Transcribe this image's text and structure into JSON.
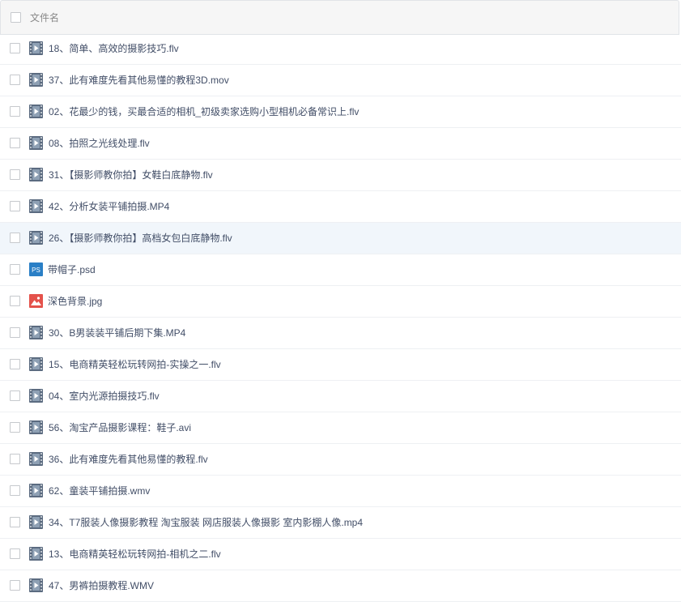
{
  "header": {
    "column_label": "文件名"
  },
  "files": [
    {
      "name": "18、简单、高效的摄影技巧.flv",
      "icon": "video-icon"
    },
    {
      "name": "37、此有难度先看其他易懂的教程3D.mov",
      "icon": "video-icon"
    },
    {
      "name": "02、花最少的钱，买最合适的相机_初级卖家选购小型相机必备常识上.flv",
      "icon": "video-icon"
    },
    {
      "name": "08、拍照之光线处理.flv",
      "icon": "video-icon"
    },
    {
      "name": "31、【摄影师教你拍】女鞋白底静物.flv",
      "icon": "video-icon"
    },
    {
      "name": "42、分析女装平铺拍摄.MP4",
      "icon": "video-icon"
    },
    {
      "name": "26、【摄影师教你拍】高档女包白底静物.flv",
      "icon": "video-icon",
      "hover": true
    },
    {
      "name": "带帽子.psd",
      "icon": "psd-icon"
    },
    {
      "name": "深色背景.jpg",
      "icon": "image-icon"
    },
    {
      "name": "30、B男装装平铺后期下集.MP4",
      "icon": "video-icon"
    },
    {
      "name": "15、电商精英轻松玩转网拍-实操之一.flv",
      "icon": "video-icon"
    },
    {
      "name": "04、室内光源拍摄技巧.flv",
      "icon": "video-icon"
    },
    {
      "name": "56、淘宝产品摄影课程：鞋子.avi",
      "icon": "video-icon"
    },
    {
      "name": "36、此有难度先看其他易懂的教程.flv",
      "icon": "video-icon"
    },
    {
      "name": "62、童装平铺拍摄.wmv",
      "icon": "video-icon"
    },
    {
      "name": "34、T7服装人像摄影教程 淘宝服装 网店服装人像摄影 室内影棚人像.mp4",
      "icon": "video-icon"
    },
    {
      "name": "13、电商精英轻松玩转网拍-相机之二.flv",
      "icon": "video-icon"
    },
    {
      "name": "47、男裤拍摄教程.WMV",
      "icon": "video-icon"
    }
  ],
  "psd_badge_text": "PS",
  "colors": {
    "video_icon": "#5b6b80",
    "psd_icon": "#2a7fc6",
    "image_icon": "#e4524b",
    "hover_row": "#f1f6fb"
  }
}
